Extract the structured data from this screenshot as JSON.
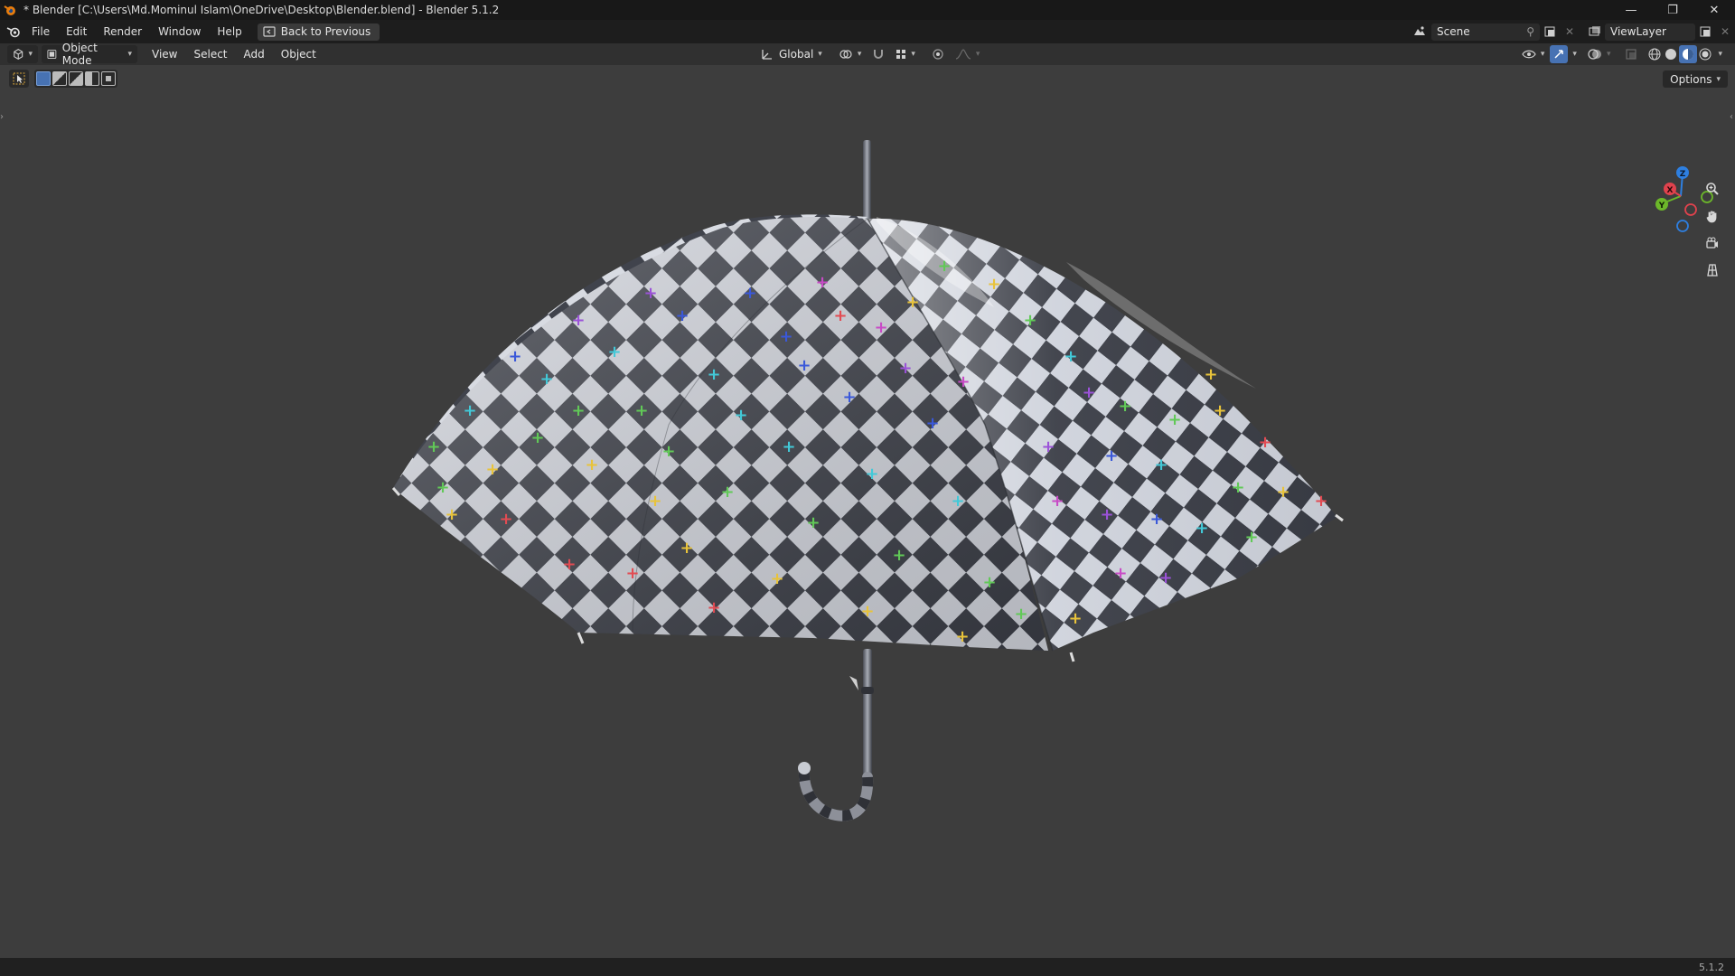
{
  "window": {
    "title": "* Blender [C:\\Users\\Md.Mominul Islam\\OneDrive\\Desktop\\Blender.blend] - Blender 5.1.2",
    "minimize": "—",
    "maximize": "❐",
    "close": "✕"
  },
  "menubar": {
    "items": [
      "File",
      "Edit",
      "Render",
      "Window",
      "Help"
    ],
    "back_button": "Back to Previous"
  },
  "scene": {
    "name": "Scene"
  },
  "view_layer": {
    "name": "ViewLayer"
  },
  "viewport_header": {
    "mode": "Object Mode",
    "menus": [
      "View",
      "Select",
      "Add",
      "Object"
    ],
    "transform_orientation": "Global"
  },
  "options_label": "Options",
  "gizmo": {
    "z": "Z",
    "y": "Y",
    "x": "X"
  },
  "version": "5.1.2",
  "colors": {
    "accent": "#4772b3",
    "axis_x": "#e0424d",
    "axis_y": "#6cb82a",
    "axis_z": "#2e7fe0"
  },
  "icons": {
    "app": "blender-logo-icon",
    "editor_type": "3d-viewport-icon",
    "zoom": "magnify-icon",
    "pan": "hand-icon",
    "camera": "camera-icon",
    "ortho": "grid-icon"
  }
}
